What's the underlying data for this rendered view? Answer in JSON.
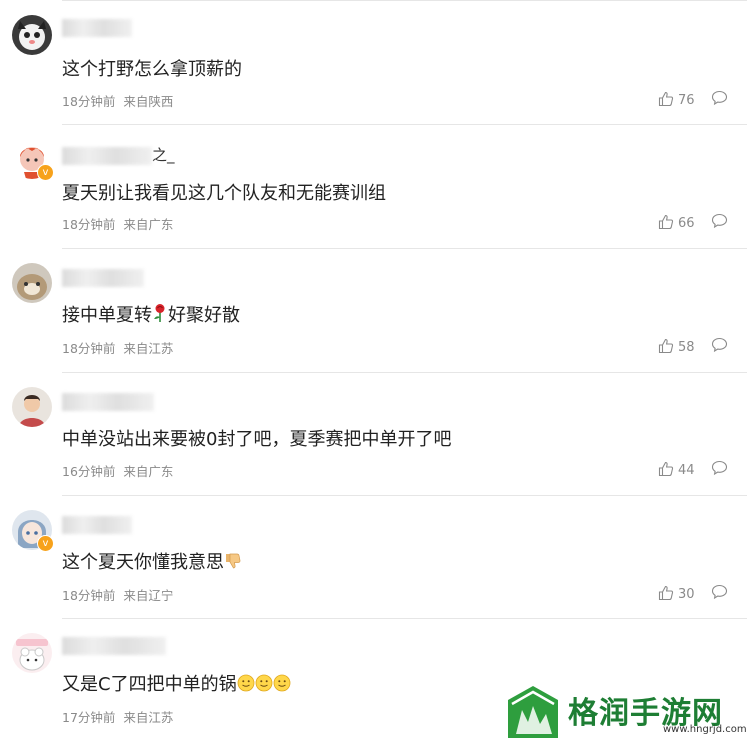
{
  "comments": [
    {
      "username_visible": "",
      "text": "这个打野怎么拿顶薪的",
      "time": "18分钟前",
      "location": "来自陕西",
      "likes": "76",
      "verified": false
    },
    {
      "username_visible": "之_",
      "text": "夏天别让我看见这几个队友和无能赛训组",
      "time": "18分钟前",
      "location": "来自广东",
      "likes": "66",
      "verified": true
    },
    {
      "username_visible": "",
      "text": "接中单夏转",
      "text_after_emoji": "好聚好散",
      "time": "18分钟前",
      "location": "来自江苏",
      "likes": "58",
      "verified": false
    },
    {
      "username_visible": "",
      "text": "中单没站出来要被0封了吧，夏季赛把中单开了吧",
      "time": "16分钟前",
      "location": "来自广东",
      "likes": "44",
      "verified": false
    },
    {
      "username_visible": "",
      "text": "这个夏天你懂我意思",
      "time": "18分钟前",
      "location": "来自辽宁",
      "likes": "30",
      "verified": true
    },
    {
      "username_visible": "",
      "text": "又是C了四把中单的锅",
      "time": "17分钟前",
      "location": "来自江苏",
      "likes": "",
      "verified": false
    }
  ],
  "icons": {
    "like": "thumbs-up-icon",
    "reply": "comment-bubble-icon",
    "rose": "rose-emoji",
    "thumbs_down": "thumbs-down-emoji",
    "smile": "smile-emoji"
  },
  "watermark": {
    "name": "格润手游网",
    "url": "www.hngrjd.com"
  },
  "colors": {
    "text": "#222222",
    "meta": "#8a8a8a",
    "divider": "#e6e6e6",
    "verified_badge": "#f7a21b",
    "watermark": "#1e7e34"
  }
}
